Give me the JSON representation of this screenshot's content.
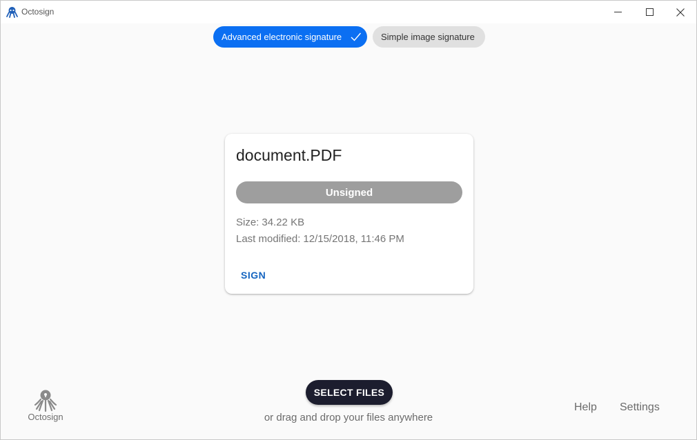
{
  "window": {
    "title": "Octosign",
    "icon": "octopus-icon",
    "controls": [
      "minimize-icon",
      "maximize-icon",
      "close-icon"
    ]
  },
  "signature_modes": {
    "advanced_label": "Advanced electronic signature",
    "simple_label": "Simple image signature",
    "selected": "advanced"
  },
  "file_card": {
    "name": "document.PDF",
    "status": "Unsigned",
    "size_label": "Size:",
    "size_value": "34.22 KB",
    "modified_label": "Last modified:",
    "modified_value": "12/15/2018, 11:46 PM",
    "action_label": "SIGN"
  },
  "footer": {
    "logo_text": "Octosign",
    "select_files_label": "SELECT FILES",
    "drop_hint": "or drag and drop your files anywhere",
    "help_label": "Help",
    "settings_label": "Settings"
  },
  "colors": {
    "accent": "#0b6ff2",
    "status_unsigned": "#9e9e9e",
    "primary_button": "#1c1d2e",
    "link": "#1565c0"
  }
}
